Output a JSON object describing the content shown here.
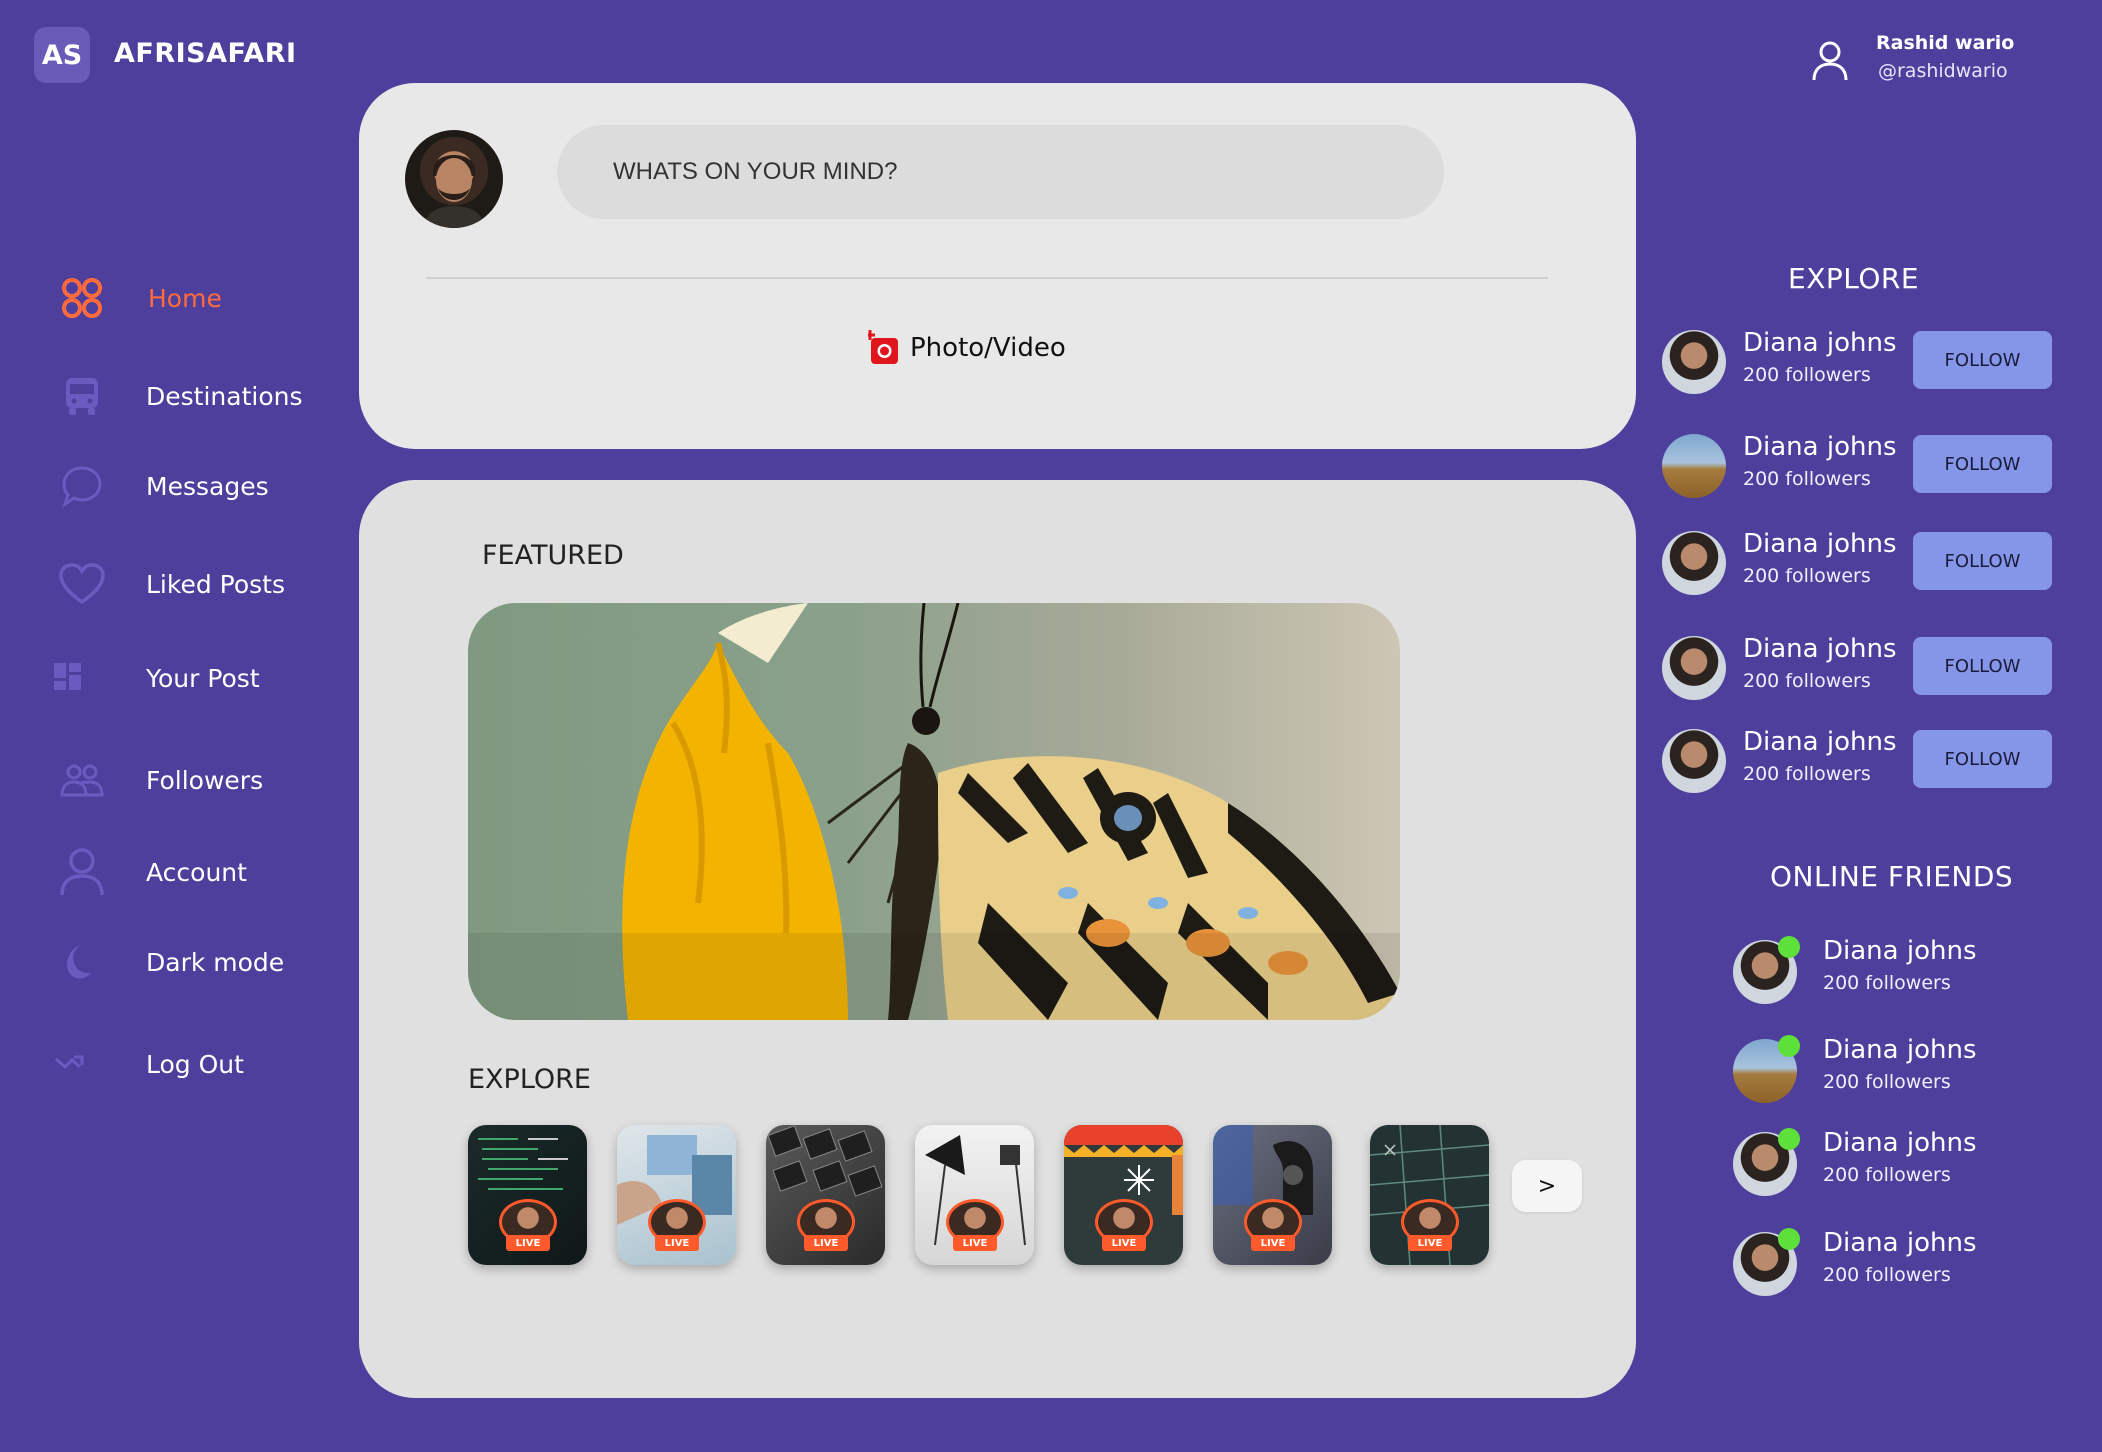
{
  "brand": {
    "badge": "AS",
    "name": "AFRISAFARI"
  },
  "user": {
    "name": "Rashid wario",
    "handle": "@rashidwario"
  },
  "sidebar": {
    "items": [
      {
        "label": "Home",
        "icon": "home-grid-icon",
        "active": true
      },
      {
        "label": "Destinations",
        "icon": "bus-icon"
      },
      {
        "label": "Messages",
        "icon": "chat-bubble-icon"
      },
      {
        "label": "Liked Posts",
        "icon": "heart-icon"
      },
      {
        "label": "Your Post",
        "icon": "dashboard-icon"
      },
      {
        "label": "Followers",
        "icon": "people-icon"
      },
      {
        "label": "Account",
        "icon": "user-icon"
      },
      {
        "label": "Dark mode",
        "icon": "moon-icon"
      },
      {
        "label": "Log Out",
        "icon": "logout-arrow-icon"
      }
    ]
  },
  "compose": {
    "placeholder": "WHATS ON YOUR MIND?",
    "photo_video_label": "Photo/Video"
  },
  "feed": {
    "featured_title": "FEATURED",
    "explore_title": "EXPLORE",
    "stories": [
      {
        "badge": "LIVE",
        "theme": "code"
      },
      {
        "badge": "LIVE",
        "theme": "lab"
      },
      {
        "badge": "LIVE",
        "theme": "keyboard"
      },
      {
        "badge": "LIVE",
        "theme": "studio"
      },
      {
        "badge": "LIVE",
        "theme": "poster"
      },
      {
        "badge": "LIVE",
        "theme": "camera"
      },
      {
        "badge": "LIVE",
        "theme": "board"
      }
    ],
    "next_label": ">"
  },
  "explore": {
    "title": "EXPLORE",
    "suggestions": [
      {
        "name": "Diana johns",
        "followers": "200 followers",
        "button": "FOLLOW"
      },
      {
        "name": "Diana johns",
        "followers": "200 followers",
        "button": "FOLLOW"
      },
      {
        "name": "Diana johns",
        "followers": "200 followers",
        "button": "FOLLOW"
      },
      {
        "name": "Diana johns",
        "followers": "200 followers",
        "button": "FOLLOW"
      },
      {
        "name": "Diana johns",
        "followers": "200 followers",
        "button": "FOLLOW"
      }
    ]
  },
  "online_friends": {
    "title": "ONLINE FRIENDS",
    "friends": [
      {
        "name": "Diana johns",
        "followers": "200 followers"
      },
      {
        "name": "Diana johns",
        "followers": "200 followers"
      },
      {
        "name": "Diana johns",
        "followers": "200 followers"
      },
      {
        "name": "Diana johns",
        "followers": "200 followers"
      }
    ]
  },
  "colors": {
    "background": "#4f3f9c",
    "accent": "#ff6b3d",
    "card": "#e8e8e8",
    "follow_button": "#8596e8",
    "online_dot": "#5ee03a"
  }
}
